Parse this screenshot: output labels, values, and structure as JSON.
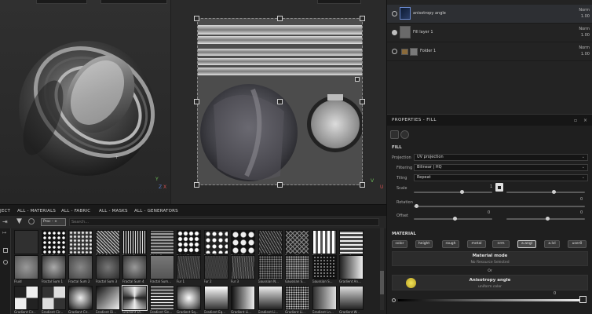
{
  "viewport": {
    "axis_y": "Y",
    "axis_x": "X",
    "axis_z": "Z",
    "axis_u": "U",
    "axis_v": "V"
  },
  "layers": {
    "items": [
      {
        "name": "anisotropy angle",
        "blend": "Norm",
        "opacity": "1.00",
        "selected": true,
        "visible": false
      },
      {
        "name": "Fill layer 1",
        "blend": "Norm",
        "opacity": "1.00",
        "selected": false,
        "visible": true
      },
      {
        "name": "Folder 1",
        "blend": "Norm",
        "opacity": "1.00",
        "selected": false,
        "visible": false
      }
    ]
  },
  "properties": {
    "title": "PROPERTIES - FILL",
    "fill_section": "FILL",
    "projection_label": "Projection",
    "projection_value": "UV projection",
    "filtering_label": "Filtering",
    "filtering_value": "Bilinear | HQ",
    "tiling_label": "Tiling",
    "tiling_value": "Repeat",
    "scale_label": "Scale",
    "scale_value": "1",
    "rotation_label": "Rotation",
    "rotation_value": "0",
    "offset_label": "Offset",
    "offset_value_1": "0",
    "offset_value_2": "0",
    "material_section": "MATERIAL",
    "channels": [
      "color",
      "height",
      "rough",
      "metal",
      "nrm",
      "a.angl",
      "a.lvl",
      "user0"
    ],
    "material_mode_title": "Material mode",
    "material_mode_sub": "No Resource Selected",
    "or_label": "Or",
    "anisotropy_title": "Anisotropy angle",
    "anisotropy_sub": "uniform color",
    "bottom_slider_value": "0"
  },
  "shelf": {
    "tabs": [
      "JECT",
      "ALL - MATERIALS",
      "ALL - FABRIC",
      "ALL - MASKS",
      "ALL - GENERATORS"
    ],
    "filter_chip": "Proc - ×",
    "search_placeholder": "Search...",
    "row1_labels": [
      "",
      "Fabric Medi...",
      "Fabric Medi...",
      "Fabric Puff...",
      "Fabric Squa...",
      "Fabric Squa...",
      "Fabric Squa...",
      "Fabric Star...",
      "Fabric Star...",
      "Fabric Titan...",
      "Fence 01",
      "Fiber 1",
      "Fibers 1"
    ],
    "row2_labels": [
      "Fluid",
      "Fractal Sum 1",
      "Fractal Sum 2",
      "Fractal Sum 3",
      "Fractal Sum 4",
      "Fractal Sum...",
      "Fur 1",
      "Fur 2",
      "Fur 3",
      "Gaussian N...",
      "Gaussian S...",
      "Gaussian S...",
      "Gradient An..."
    ],
    "row3_labels": [
      "Gradient Cir...",
      "Gradient Cir...",
      "Gradient Cir...",
      "Gradient Di...",
      "Gradient Di...",
      "Gradient Sin...",
      "Gradient Sq...",
      "Gradient Eq...",
      "Gradient Li...",
      "Gradient Li...",
      "Gradient Li...",
      "Gradient Ln...",
      "Gradient W..."
    ]
  }
}
